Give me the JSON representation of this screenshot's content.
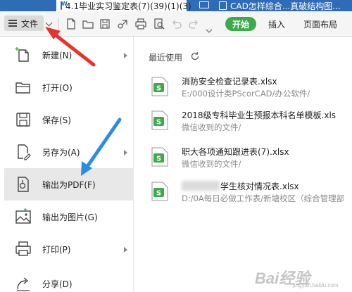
{
  "titlebar": {
    "tab1": "4.1毕业实习鉴定表(7)(39)(1)(3)",
    "tab2": "CAD怎样综合...真破结构图..."
  },
  "ribbon": {
    "file_label": "文件",
    "start_label": "开始",
    "insert_label": "插入",
    "layout_label": "页面布局",
    "toolbar_icons": [
      "new-doc-icon",
      "open-folder-icon",
      "save-icon",
      "export-icon",
      "print-icon",
      "print-preview-icon",
      "undo-icon",
      "redo-icon",
      "more-icon"
    ]
  },
  "menu": {
    "items": [
      {
        "label": "新建(N)",
        "icon": "new-icon",
        "submenu": true
      },
      {
        "label": "打开(O)",
        "icon": "folder-icon",
        "submenu": false
      },
      {
        "label": "保存(S)",
        "icon": "save-icon",
        "submenu": false
      },
      {
        "label": "另存为(A)",
        "icon": "save-as-icon",
        "submenu": true
      },
      {
        "label": "输出为PDF(F)",
        "icon": "pdf-export-icon",
        "submenu": false,
        "highlighted": true
      },
      {
        "label": "输出为图片(G)",
        "icon": "image-export-icon",
        "submenu": false
      },
      {
        "label": "打印(P)",
        "icon": "printer-icon",
        "submenu": true
      },
      {
        "label": "分享(D)",
        "icon": "share-icon",
        "submenu": false
      }
    ]
  },
  "recent": {
    "title": "最近使用",
    "files": [
      {
        "name": "消防安全检查记录表.xlsx",
        "path": "E:/000设计类PScorCAD/办公软件/"
      },
      {
        "name": "2018级专科毕业生预报本科名单模板.xls",
        "path": "微信收到的文件/"
      },
      {
        "name": "职大各项通知跟进表(7).xlsx",
        "path": "微信收到的文件/"
      },
      {
        "name": "学生核对情况表.xlsx",
        "path": "D:/0A每日必做工作表/新塘校区（综合管理部"
      }
    ]
  },
  "watermark": {
    "text": "Bai经验",
    "sub": "jingyan.baidu.com"
  },
  "colors": {
    "titlebar": "#2f6cb7",
    "start_pill": "#3daa4b",
    "annotation_red": "#e8332a",
    "annotation_blue": "#2a8be8",
    "file_icon_green": "#3daa4b"
  }
}
